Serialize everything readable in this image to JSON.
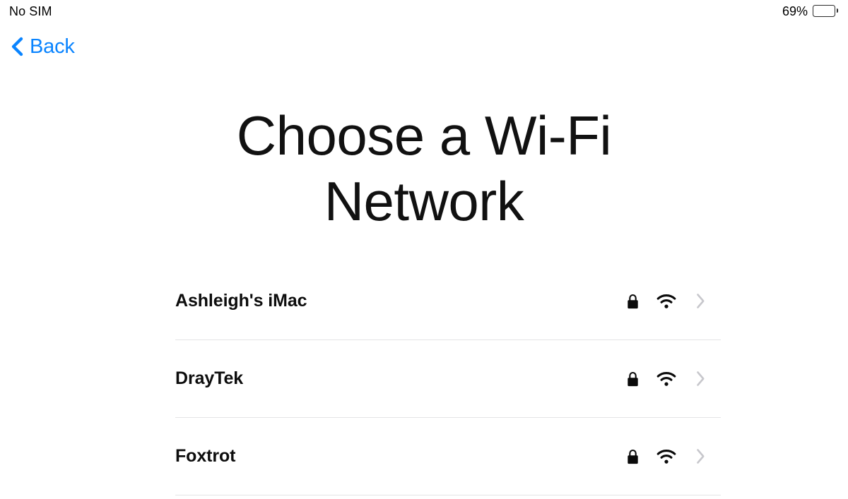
{
  "status_bar": {
    "carrier": "No SIM",
    "battery_percent_label": "69%",
    "battery_level": 69,
    "battery_icon": "battery-icon"
  },
  "navigation": {
    "back_label": "Back",
    "back_icon": "chevron-left-icon",
    "accent_color": "#0a84ff"
  },
  "main": {
    "title": "Choose a Wi-Fi\nNetwork"
  },
  "networks": {
    "lock_icon": "lock-icon",
    "wifi_icon": "wifi-icon",
    "disclosure_icon": "chevron-right-icon",
    "items": [
      {
        "name": "Ashleigh's iMac",
        "secured": true,
        "signal_bars": 3
      },
      {
        "name": "DrayTek",
        "secured": true,
        "signal_bars": 3
      },
      {
        "name": "Foxtrot",
        "secured": true,
        "signal_bars": 3
      }
    ]
  },
  "colors": {
    "background": "#ffffff",
    "text_primary": "#0d0d0d",
    "divider": "#e3e3e5",
    "chevron_gray": "#c7c7cc",
    "accent_blue": "#0a84ff"
  }
}
